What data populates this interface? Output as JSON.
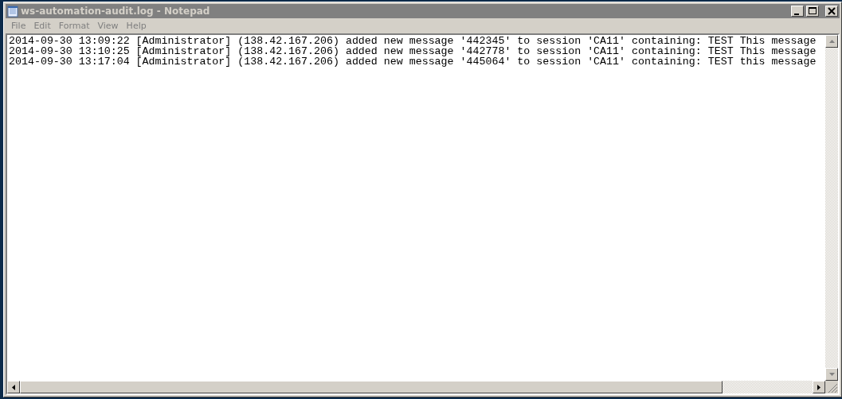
{
  "window": {
    "title": "ws-automation-audit.log - Notepad"
  },
  "menu": [
    "File",
    "Edit",
    "Format",
    "View",
    "Help"
  ],
  "lines": [
    "2014-09-30 13:09:22 [Administrator] (138.42.167.206) added new message '442345' to session 'CA11' containing: TEST This message",
    "2014-09-30 13:10:25 [Administrator] (138.42.167.206) added new message '442778' to session 'CA11' containing: TEST This message",
    "2014-09-30 13:17:04 [Administrator] (138.42.167.206) added new message '445064' to session 'CA11' containing: TEST this message"
  ]
}
